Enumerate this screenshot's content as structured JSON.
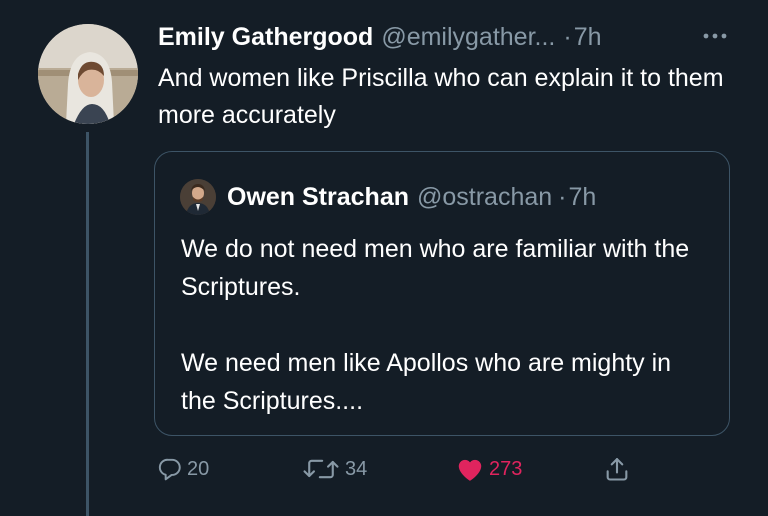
{
  "tweet": {
    "author_name": "Emily Gathergood",
    "author_handle": "@emilygather...",
    "separator": "·",
    "time": "7h",
    "text": "And women like Priscilla who can explain it to them more accurately"
  },
  "quoted_tweet": {
    "author_name": "Owen Strachan",
    "author_handle": "@ostrachan",
    "separator": "·",
    "time": "7h",
    "paragraphs": [
      "We do not need men who are familiar with the Scriptures.",
      "We need men like Apollos who are mighty in the Scriptures...."
    ]
  },
  "actions": {
    "reply_count": "20",
    "retweet_count": "34",
    "like_count": "273",
    "liked": true
  },
  "icons": {
    "more": "more-horizontal-icon",
    "reply": "reply-bubble-icon",
    "retweet": "retweet-icon",
    "like": "heart-icon",
    "share": "share-icon"
  },
  "colors": {
    "background": "#141d26",
    "text_primary": "#ffffff",
    "text_secondary": "#8899a6",
    "border": "#3d5466",
    "like": "#e0245e"
  }
}
